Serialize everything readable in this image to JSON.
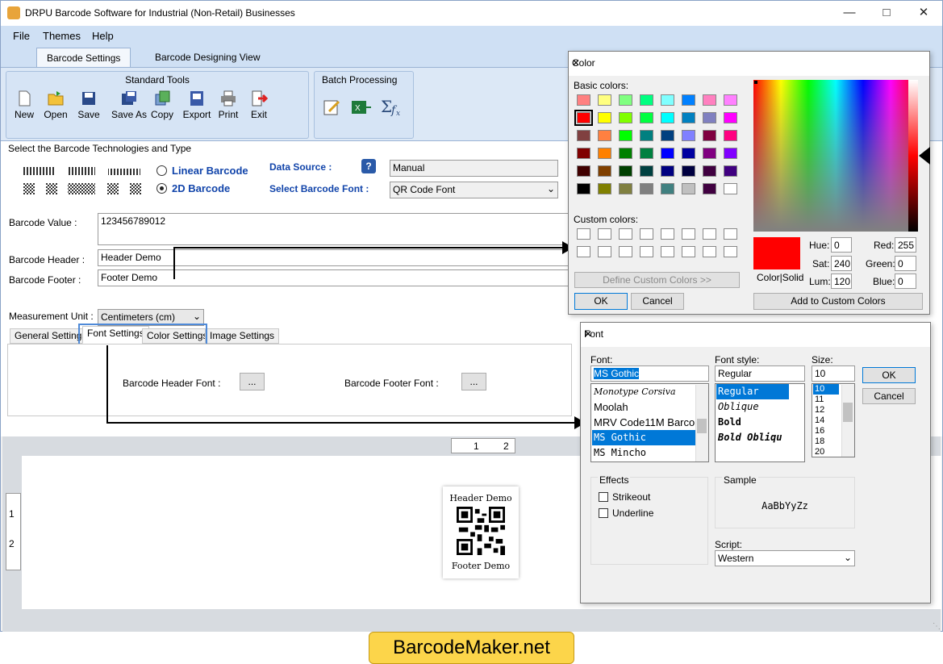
{
  "window": {
    "title": "DRPU Barcode Software for Industrial (Non-Retail) Businesses"
  },
  "menu": [
    "File",
    "Themes",
    "Help"
  ],
  "ribbon_tabs": [
    "Barcode Settings",
    "Barcode Designing View"
  ],
  "standard_tools": {
    "title": "Standard Tools",
    "items": [
      "New",
      "Open",
      "Save",
      "Save As",
      "Copy",
      "Export",
      "Print",
      "Exit"
    ]
  },
  "batch": {
    "title": "Batch Processing"
  },
  "tech": {
    "title": "Select the Barcode Technologies and Type",
    "linear": "Linear Barcode",
    "twod": "2D Barcode",
    "data_source_label": "Data Source :",
    "data_source_value": "Manual",
    "font_label": "Select Barcode Font :",
    "font_value": "QR Code Font"
  },
  "fields": {
    "value_label": "Barcode Value :",
    "value": "123456789012",
    "header_label": "Barcode Header :",
    "header": "Header Demo",
    "footer_label": "Barcode Footer :",
    "footer": "Footer Demo",
    "unit_label": "Measurement Unit :",
    "unit": "Centimeters (cm)"
  },
  "subtabs": [
    "General Settings",
    "Font Settings",
    "Color Settings",
    "Image Settings"
  ],
  "font_settings": {
    "header_font": "Barcode Header Font :",
    "footer_font": "Barcode Footer Font :",
    "btn": "..."
  },
  "ruler": {
    "h1": "1",
    "h2": "2",
    "v1": "1",
    "v2": "2"
  },
  "preview": {
    "header": "Header Demo",
    "footer": "Footer Demo"
  },
  "color_dialog": {
    "title": "Color",
    "basic": "Basic colors:",
    "custom": "Custom colors:",
    "define": "Define Custom Colors >>",
    "ok": "OK",
    "cancel": "Cancel",
    "colorsolid": "Color|Solid",
    "hue_l": "Hue:",
    "hue": "0",
    "sat_l": "Sat:",
    "sat": "240",
    "lum_l": "Lum:",
    "lum": "120",
    "red_l": "Red:",
    "red": "255",
    "green_l": "Green:",
    "green": "0",
    "blue_l": "Blue:",
    "blue": "0",
    "add": "Add to Custom Colors",
    "basic_colors": [
      "#ff8080",
      "#ffff80",
      "#80ff80",
      "#00ff80",
      "#80ffff",
      "#0080ff",
      "#ff80c0",
      "#ff80ff",
      "#ff0000",
      "#ffff00",
      "#80ff00",
      "#00ff40",
      "#00ffff",
      "#0080c0",
      "#8080c0",
      "#ff00ff",
      "#804040",
      "#ff8040",
      "#00ff00",
      "#008080",
      "#004080",
      "#8080ff",
      "#800040",
      "#ff0080",
      "#800000",
      "#ff8000",
      "#008000",
      "#008040",
      "#0000ff",
      "#0000a0",
      "#800080",
      "#8000ff",
      "#400000",
      "#804000",
      "#004000",
      "#004040",
      "#000080",
      "#000040",
      "#400040",
      "#400080",
      "#000000",
      "#808000",
      "#808040",
      "#808080",
      "#408080",
      "#c0c0c0",
      "#400040",
      "#ffffff"
    ]
  },
  "font_dialog": {
    "title": "Font",
    "font_l": "Font:",
    "font": "MS Gothic",
    "style_l": "Font style:",
    "style": "Regular",
    "size_l": "Size:",
    "size": "10",
    "fonts": [
      "Monotype Corsiva",
      "Moolah",
      "MRV Code11M Barco",
      "MS Gothic",
      "MS Mincho"
    ],
    "styles": [
      "Regular",
      "Oblique",
      "Bold",
      "Bold Obliqu"
    ],
    "sizes": [
      "10",
      "11",
      "12",
      "14",
      "16",
      "18",
      "20"
    ],
    "ok": "OK",
    "cancel": "Cancel",
    "effects": "Effects",
    "strike": "Strikeout",
    "underline": "Underline",
    "sample_l": "Sample",
    "sample": "AaBbYyZz",
    "script_l": "Script:",
    "script": "Western"
  },
  "brand": "BarcodeMaker.net"
}
